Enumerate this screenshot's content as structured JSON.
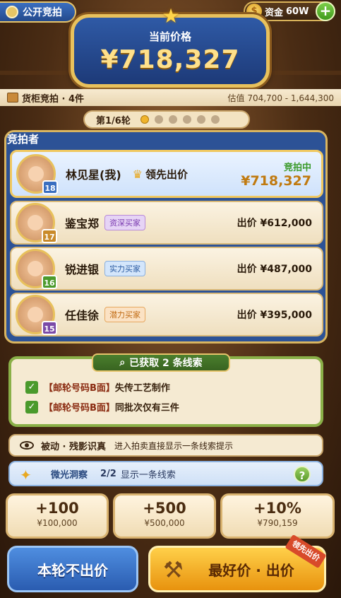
{
  "top": {
    "auction_label": "公开竞拍",
    "funds_label": "资金",
    "funds_value": "60W",
    "coin_symbol": "$",
    "add_symbol": "+"
  },
  "price": {
    "label": "当前价格",
    "value": "¥718,327"
  },
  "info": {
    "lot": "货柜竞拍 · 4件",
    "estimate": "估值 704,700 - 1,644,300"
  },
  "rounds": {
    "label": "第1/6轮",
    "total": 6,
    "current": 1
  },
  "bidders_title": "竞拍者",
  "bidders": [
    {
      "name": "林见星(我)",
      "level": "18",
      "status_label": "领先出价",
      "status": "竞拍中",
      "amount": "¥718,327"
    },
    {
      "name": "鉴宝郑",
      "level": "17",
      "tag": "资深买家",
      "bid": "出价 ¥612,000"
    },
    {
      "name": "锐进银",
      "level": "16",
      "tag": "实力买家",
      "bid": "出价 ¥487,000"
    },
    {
      "name": "任佳徐",
      "level": "15",
      "tag": "潜力买家",
      "bid": "出价 ¥395,000"
    }
  ],
  "clues": {
    "header": "已获取 2 条线索",
    "items": [
      {
        "key": "【邮轮号码B面】",
        "text": "失传工艺制作"
      },
      {
        "key": "【邮轮号码B面】",
        "text": "同批次仅有三件"
      }
    ]
  },
  "passive": {
    "name": "被动 · 残影识真",
    "desc": "进入拍卖直接显示一条线索提示"
  },
  "skill": {
    "name": "微光洞察",
    "count": "2/2",
    "desc": "显示一条线索",
    "help": "?"
  },
  "increments": [
    {
      "label": "+100",
      "amount": "¥100,000"
    },
    {
      "label": "+500",
      "amount": "¥500,000"
    },
    {
      "label": "+10%",
      "amount": "¥790,159"
    }
  ],
  "buttons": {
    "pass": "本轮不出价",
    "best": "最好价 · 出价",
    "ribbon": "领先出价"
  }
}
